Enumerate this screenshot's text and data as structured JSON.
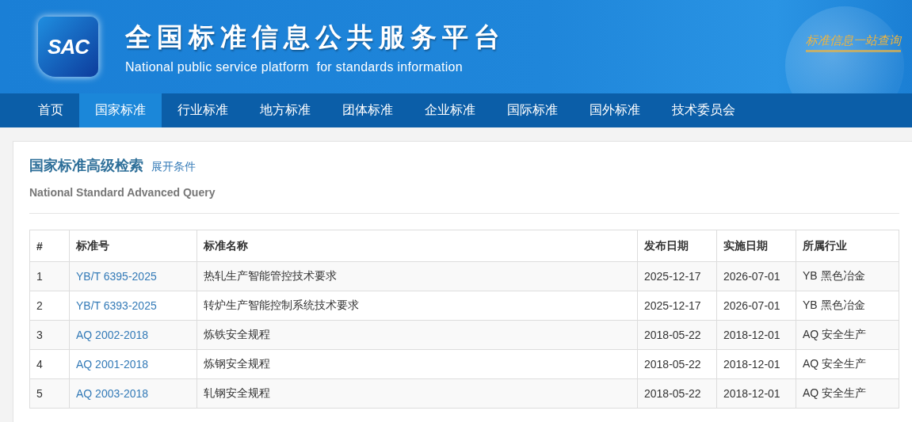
{
  "header": {
    "logo": "SAC",
    "title": "全国标准信息公共服务平台",
    "subtitle": "National public service platform  for standards information",
    "slogan": "标准信息一站查询"
  },
  "nav": [
    {
      "label": "首页",
      "selected": false
    },
    {
      "label": "国家标准",
      "selected": true
    },
    {
      "label": "行业标准",
      "selected": false
    },
    {
      "label": "地方标准",
      "selected": false
    },
    {
      "label": "团体标准",
      "selected": false
    },
    {
      "label": "企业标准",
      "selected": false
    },
    {
      "label": "国际标准",
      "selected": false
    },
    {
      "label": "国外标准",
      "selected": false
    },
    {
      "label": "技术委员会",
      "selected": false
    }
  ],
  "search": {
    "title": "国家标准高级检索",
    "toggle": "展开条件",
    "subtitle": "National Standard Advanced Query"
  },
  "table": {
    "columns": [
      "#",
      "标准号",
      "标准名称",
      "发布日期",
      "实施日期",
      "所属行业"
    ],
    "rows": [
      [
        "1",
        "YB/T 6395-2025",
        "热轧生产智能管控技术要求",
        "2025-12-17",
        "2026-07-01",
        "YB 黑色冶金"
      ],
      [
        "2",
        "YB/T 6393-2025",
        "转炉生产智能控制系统技术要求",
        "2025-12-17",
        "2026-07-01",
        "YB 黑色冶金"
      ],
      [
        "3",
        "AQ 2002-2018",
        "炼铁安全规程",
        "2018-05-22",
        "2018-12-01",
        "AQ 安全生产"
      ],
      [
        "4",
        "AQ 2001-2018",
        "炼钢安全规程",
        "2018-05-22",
        "2018-12-01",
        "AQ 安全生产"
      ],
      [
        "5",
        "AQ 2003-2018",
        "轧钢安全规程",
        "2018-05-22",
        "2018-12-01",
        "AQ 安全生产"
      ]
    ]
  }
}
